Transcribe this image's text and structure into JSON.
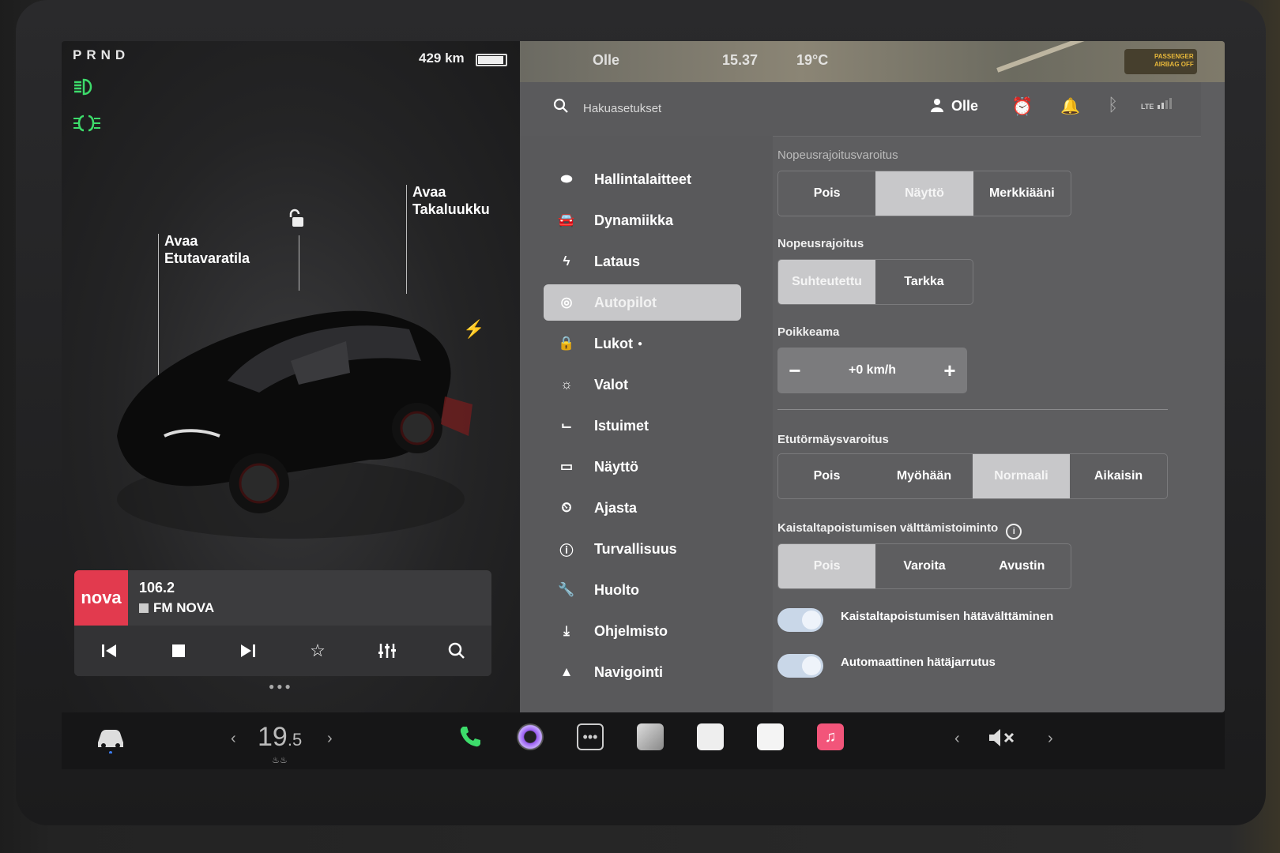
{
  "status": {
    "gear": "PRND",
    "range": "429 km"
  },
  "car_panel": {
    "callout_frunk": "Avaa\nEtutavaratila",
    "callout_trunk": "Avaa\nTakaluukku"
  },
  "media": {
    "frequency": "106.2",
    "station": "FM NOVA",
    "logo_text": "nova"
  },
  "map_strip": {
    "user": "Olle",
    "time": "15.37",
    "temp": "19°C",
    "airbag_label": "PASSENGER AIRBAG OFF"
  },
  "header": {
    "search_placeholder": "Hakuasetukset",
    "user": "Olle",
    "network": "LTE"
  },
  "sidebar": {
    "items": [
      {
        "label": "Hallintalaitteet",
        "icon": "toggle-icon"
      },
      {
        "label": "Dynamiikka",
        "icon": "car-icon"
      },
      {
        "label": "Lataus",
        "icon": "bolt-icon"
      },
      {
        "label": "Autopilot",
        "icon": "steering-wheel-icon"
      },
      {
        "label": "Lukot",
        "icon": "lock-icon"
      },
      {
        "label": "Valot",
        "icon": "sun-icon"
      },
      {
        "label": "Istuimet",
        "icon": "seat-icon"
      },
      {
        "label": "Näyttö",
        "icon": "display-icon"
      },
      {
        "label": "Ajasta",
        "icon": "clock-icon"
      },
      {
        "label": "Turvallisuus",
        "icon": "alert-icon"
      },
      {
        "label": "Huolto",
        "icon": "wrench-icon"
      },
      {
        "label": "Ohjelmisto",
        "icon": "download-icon"
      },
      {
        "label": "Navigointi",
        "icon": "navigation-icon"
      }
    ],
    "active": "Autopilot"
  },
  "settings": {
    "speed_warning": {
      "label": "Nopeusrajoitusvaroitus",
      "options": [
        "Pois",
        "Näyttö",
        "Merkkiääni"
      ],
      "selected": "Näyttö"
    },
    "speed_limit": {
      "label": "Nopeusrajoitus",
      "options": [
        "Suhteutettu",
        "Tarkka"
      ],
      "selected": "Suhteutettu"
    },
    "offset": {
      "label": "Poikkeama",
      "value": "+0 km/h"
    },
    "collision_warning": {
      "label": "Etutörmäysvaroitus",
      "options": [
        "Pois",
        "Myöhään",
        "Normaali",
        "Aikaisin"
      ],
      "selected": "Normaali"
    },
    "lane_departure": {
      "label": "Kaistaltapoistumisen välttämistoiminto",
      "options": [
        "Pois",
        "Varoita",
        "Avustin"
      ],
      "selected": "Pois"
    },
    "emergency_lane": {
      "label": "Kaistaltapoistumisen hätävälttäminen",
      "on": true
    },
    "auto_brake": {
      "label": "Automaattinen hätäjarrutus",
      "on": true
    }
  },
  "taskbar": {
    "temp_whole": "19",
    "temp_dec": ".5"
  },
  "colors": {
    "accent_green": "#3ddc6b",
    "alarm_yellow": "#f0c23a",
    "radio_red": "#e23a4e",
    "toggle_blue": "#c9d7e8"
  }
}
